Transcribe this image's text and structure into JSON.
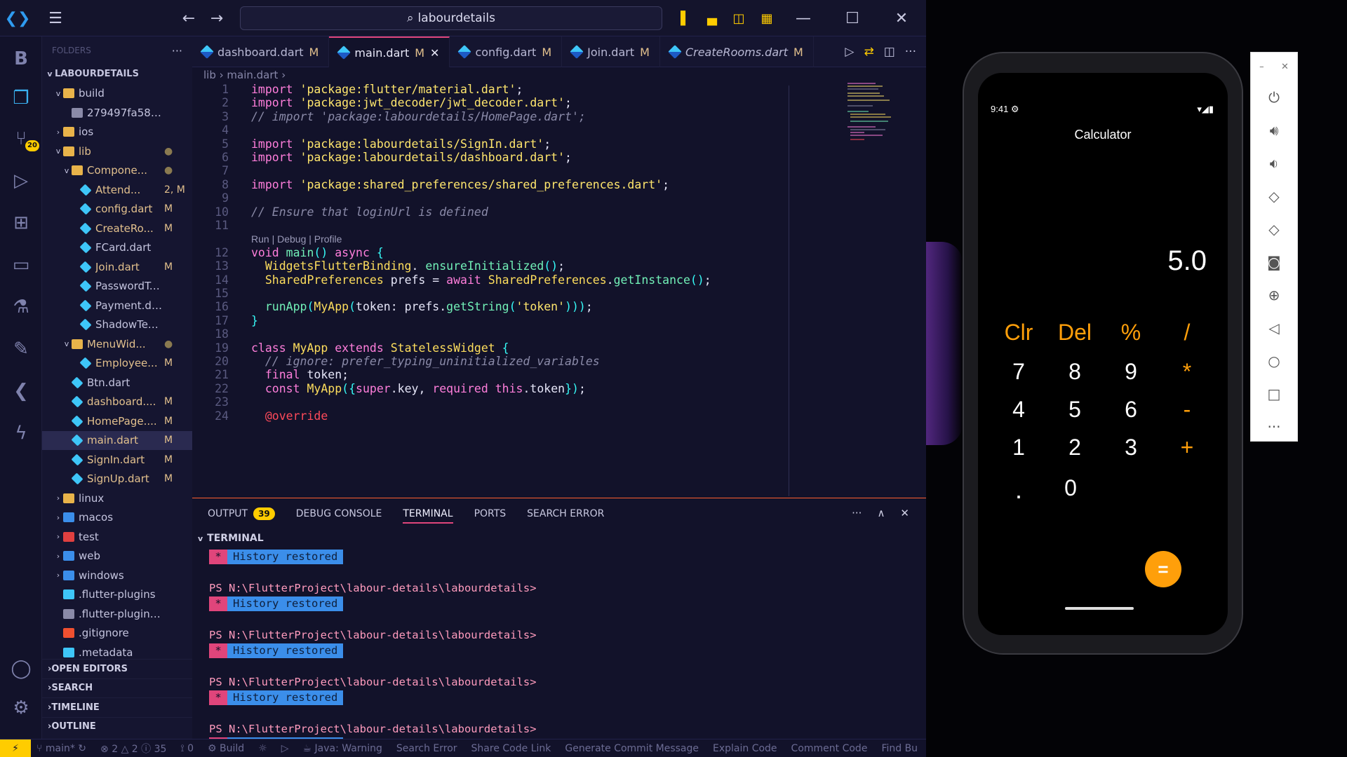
{
  "titlebar": {
    "search_text": "labourdetails"
  },
  "activity": {
    "letter": "B",
    "scm_badge": "20"
  },
  "sidebar": {
    "header": "FOLDERS",
    "root": "LABOURDETAILS",
    "rows": [
      {
        "indent": 1,
        "chev": "v",
        "icon": "folder",
        "name": "build",
        "stat": ""
      },
      {
        "indent": 2,
        "chev": "",
        "icon": "file",
        "name": "279497fa5855e...",
        "stat": ""
      },
      {
        "indent": 1,
        "chev": ">",
        "icon": "folder",
        "name": "ios",
        "stat": ""
      },
      {
        "indent": 1,
        "chev": "v",
        "icon": "folder",
        "name": "lib",
        "stat": "●",
        "color": "mod"
      },
      {
        "indent": 2,
        "chev": "v",
        "icon": "folder",
        "name": "Compone...",
        "stat": "●",
        "color": "mod"
      },
      {
        "indent": 3,
        "chev": "",
        "icon": "dart",
        "name": "Attend...",
        "stat": "2, M",
        "color": "mod"
      },
      {
        "indent": 3,
        "chev": "",
        "icon": "dart",
        "name": "config.dart",
        "stat": "M",
        "color": "mod"
      },
      {
        "indent": 3,
        "chev": "",
        "icon": "dart",
        "name": "CreateRo...",
        "stat": "M",
        "color": "mod"
      },
      {
        "indent": 3,
        "chev": "",
        "icon": "dart",
        "name": "FCard.dart",
        "stat": ""
      },
      {
        "indent": 3,
        "chev": "",
        "icon": "dart",
        "name": "Join.dart",
        "stat": "M",
        "color": "mod"
      },
      {
        "indent": 3,
        "chev": "",
        "icon": "dart",
        "name": "PasswordText.d...",
        "stat": ""
      },
      {
        "indent": 3,
        "chev": "",
        "icon": "dart",
        "name": "Payment.dart",
        "stat": ""
      },
      {
        "indent": 3,
        "chev": "",
        "icon": "dart",
        "name": "ShadowTextFiel...",
        "stat": ""
      },
      {
        "indent": 2,
        "chev": "v",
        "icon": "folder",
        "name": "MenuWid...",
        "stat": "●",
        "color": "mod"
      },
      {
        "indent": 3,
        "chev": "",
        "icon": "dart",
        "name": "Employee...",
        "stat": "M",
        "color": "mod"
      },
      {
        "indent": 2,
        "chev": "",
        "icon": "dart",
        "name": "Btn.dart",
        "stat": ""
      },
      {
        "indent": 2,
        "chev": "",
        "icon": "dart",
        "name": "dashboard....",
        "stat": "M",
        "color": "mod"
      },
      {
        "indent": 2,
        "chev": "",
        "icon": "dart",
        "name": "HomePage....",
        "stat": "M",
        "color": "mod"
      },
      {
        "indent": 2,
        "chev": "",
        "icon": "dart",
        "name": "main.dart",
        "stat": "M",
        "color": "mod",
        "selected": true
      },
      {
        "indent": 2,
        "chev": "",
        "icon": "dart",
        "name": "SignIn.dart",
        "stat": "M",
        "color": "mod"
      },
      {
        "indent": 2,
        "chev": "",
        "icon": "dart",
        "name": "SignUp.dart",
        "stat": "M",
        "color": "mod"
      },
      {
        "indent": 1,
        "chev": ">",
        "icon": "folder-linux",
        "name": "linux",
        "stat": ""
      },
      {
        "indent": 1,
        "chev": ">",
        "icon": "folder-mac",
        "name": "macos",
        "stat": ""
      },
      {
        "indent": 1,
        "chev": ">",
        "icon": "folder-test",
        "name": "test",
        "stat": ""
      },
      {
        "indent": 1,
        "chev": ">",
        "icon": "folder-web",
        "name": "web",
        "stat": ""
      },
      {
        "indent": 1,
        "chev": ">",
        "icon": "folder-win",
        "name": "windows",
        "stat": ""
      },
      {
        "indent": 1,
        "chev": "",
        "icon": "flutter",
        "name": ".flutter-plugins",
        "stat": ""
      },
      {
        "indent": 1,
        "chev": "",
        "icon": "file",
        "name": ".flutter-plugins-de...",
        "stat": ""
      },
      {
        "indent": 1,
        "chev": "",
        "icon": "git",
        "name": ".gitignore",
        "stat": ""
      },
      {
        "indent": 1,
        "chev": "",
        "icon": "flutter",
        "name": ".metadata",
        "stat": ""
      }
    ],
    "sections": [
      "OPEN EDITORS",
      "SEARCH",
      "TIMELINE",
      "OUTLINE"
    ]
  },
  "tabs": [
    {
      "name": "dashboard.dart",
      "stat": "M",
      "active": false
    },
    {
      "name": "main.dart",
      "stat": "M",
      "active": true
    },
    {
      "name": "config.dart",
      "stat": "M",
      "active": false
    },
    {
      "name": "Join.dart",
      "stat": "M",
      "active": false
    },
    {
      "name": "CreateRooms.dart",
      "stat": "M",
      "active": false
    }
  ],
  "breadcrumb": {
    "a": "lib",
    "b": "main.dart"
  },
  "codelens": "Run | Debug | Profile",
  "code": [
    {
      "n": "1",
      "t": [
        [
          "kw",
          "import "
        ],
        [
          "str",
          "'package:flutter/material.dart'"
        ],
        [
          "",
          "; "
        ]
      ]
    },
    {
      "n": "2",
      "t": [
        [
          "kw",
          "import "
        ],
        [
          "str",
          "'package:jwt_decoder/jwt_decoder.dart'"
        ],
        [
          "",
          ";"
        ]
      ]
    },
    {
      "n": "3",
      "t": [
        [
          "cm",
          "// import 'package:labourdetails/HomePage.dart';"
        ]
      ]
    },
    {
      "n": "4",
      "t": []
    },
    {
      "n": "5",
      "t": [
        [
          "kw",
          "import "
        ],
        [
          "str",
          "'package:labourdetails/SignIn.dart'"
        ],
        [
          "",
          ";"
        ]
      ]
    },
    {
      "n": "6",
      "t": [
        [
          "kw",
          "import "
        ],
        [
          "str",
          "'package:labourdetails/dashboard.dart'"
        ],
        [
          "",
          ";"
        ]
      ]
    },
    {
      "n": "7",
      "t": []
    },
    {
      "n": "8",
      "t": [
        [
          "kw",
          "import "
        ],
        [
          "str",
          "'package:shared_preferences/shared_preferences.dart'"
        ],
        [
          "",
          ";"
        ]
      ]
    },
    {
      "n": "9",
      "t": []
    },
    {
      "n": "10",
      "t": [
        [
          "cm",
          "// Ensure that loginUrl is defined"
        ]
      ]
    },
    {
      "n": "11",
      "t": []
    },
    {
      "n": "12",
      "t": [
        [
          "kw",
          "void "
        ],
        [
          "fn",
          "main"
        ],
        [
          "punc",
          "() "
        ],
        [
          "kw",
          "async "
        ],
        [
          "punc",
          "{"
        ]
      ]
    },
    {
      "n": "13",
      "t": [
        [
          "",
          "  "
        ],
        [
          "ty",
          "WidgetsFlutterBinding"
        ],
        [
          "",
          ". "
        ],
        [
          "fn",
          "ensureInitialized"
        ],
        [
          "punc",
          "()"
        ],
        [
          "",
          ";"
        ]
      ]
    },
    {
      "n": "14",
      "t": [
        [
          "",
          "  "
        ],
        [
          "ty",
          "SharedPreferences"
        ],
        [
          "",
          " prefs = "
        ],
        [
          "kw",
          "await "
        ],
        [
          "ty",
          "SharedPreferences"
        ],
        [
          "",
          "."
        ],
        [
          "fn",
          "getInstance"
        ],
        [
          "punc",
          "()"
        ],
        [
          "",
          ";"
        ]
      ]
    },
    {
      "n": "15",
      "t": []
    },
    {
      "n": "16",
      "t": [
        [
          "",
          "  "
        ],
        [
          "fn",
          "runApp"
        ],
        [
          "punc",
          "("
        ],
        [
          "ty",
          "MyApp"
        ],
        [
          "punc",
          "("
        ],
        [
          "",
          "token: prefs."
        ],
        [
          "fn",
          "getString"
        ],
        [
          "punc",
          "("
        ],
        [
          "str",
          "'token'"
        ],
        [
          "punc",
          ")))"
        ],
        [
          "",
          ";"
        ]
      ]
    },
    {
      "n": "17",
      "t": [
        [
          "punc",
          "}"
        ]
      ]
    },
    {
      "n": "18",
      "t": []
    },
    {
      "n": "19",
      "t": [
        [
          "kw",
          "class "
        ],
        [
          "ty",
          "MyApp "
        ],
        [
          "kw",
          "extends "
        ],
        [
          "ty",
          "StatelessWidget "
        ],
        [
          "punc",
          "{"
        ]
      ]
    },
    {
      "n": "20",
      "t": [
        [
          "cm",
          "  // ignore: prefer_typing_uninitialized_variables"
        ]
      ]
    },
    {
      "n": "21",
      "t": [
        [
          "",
          "  "
        ],
        [
          "kw",
          "final "
        ],
        [
          "",
          "token;"
        ]
      ]
    },
    {
      "n": "22",
      "t": [
        [
          "",
          "  "
        ],
        [
          "kw",
          "const "
        ],
        [
          "ty",
          "MyApp"
        ],
        [
          "punc",
          "({"
        ],
        [
          "kw",
          "super"
        ],
        [
          "",
          ".key, "
        ],
        [
          "kw",
          "required "
        ],
        [
          "kw",
          "this"
        ],
        [
          "",
          ".token"
        ],
        [
          "punc",
          "})"
        ],
        [
          "",
          ";"
        ]
      ]
    },
    {
      "n": "23",
      "t": []
    },
    {
      "n": "24",
      "t": [
        [
          "err",
          "  @override"
        ]
      ]
    }
  ],
  "panel": {
    "tabs": [
      "OUTPUT",
      "DEBUG CONSOLE",
      "TERMINAL",
      "PORTS",
      "SEARCH ERROR"
    ],
    "output_count": "39",
    "terminal_label": "TERMINAL",
    "history_star": "*",
    "history_msg": "History restored",
    "prompt": "PS N:\\FlutterProject\\labour-details\\labourdetails>"
  },
  "status": {
    "branch": "main*",
    "problems": "⊗ 2 △ 2 ⓘ 35",
    "ports": "0",
    "build": "Build",
    "java": "Java: Warning",
    "items": [
      "Search Error",
      "Share Code Link",
      "Generate Commit Message",
      "Explain Code",
      "Comment Code",
      "Find Bu"
    ]
  },
  "phone": {
    "time": "9:41",
    "title": "Calculator",
    "display": "5.0",
    "rows": [
      [
        {
          "k": "Clr",
          "op": true
        },
        {
          "k": "Del",
          "op": true
        },
        {
          "k": "%",
          "op": true
        },
        {
          "k": "/",
          "op": true
        }
      ],
      [
        {
          "k": "7"
        },
        {
          "k": "8"
        },
        {
          "k": "9"
        },
        {
          "k": "*",
          "op": true
        }
      ],
      [
        {
          "k": "4"
        },
        {
          "k": "5"
        },
        {
          "k": "6"
        },
        {
          "k": "-",
          "op": true
        }
      ],
      [
        {
          "k": "1"
        },
        {
          "k": "2"
        },
        {
          "k": "3"
        },
        {
          "k": "+",
          "op": true
        }
      ],
      [
        {
          "k": "."
        },
        {
          "k": "0"
        }
      ]
    ],
    "equals": "="
  }
}
